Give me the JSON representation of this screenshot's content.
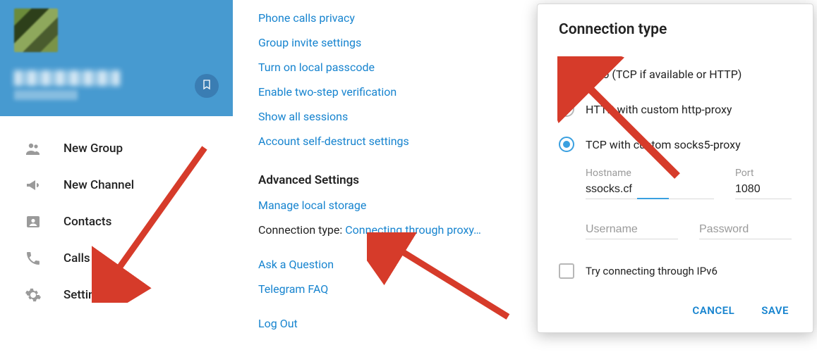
{
  "sidebar": {
    "items": [
      {
        "label": "New Group",
        "icon": "people"
      },
      {
        "label": "New Channel",
        "icon": "megaphone"
      },
      {
        "label": "Contacts",
        "icon": "person"
      },
      {
        "label": "Calls",
        "icon": "phone"
      },
      {
        "label": "Settings",
        "icon": "gear"
      }
    ]
  },
  "main": {
    "privacy_links": [
      "Phone calls privacy",
      "Group invite settings",
      "Turn on local passcode",
      "Enable two-step verification",
      "Show all sessions",
      "Account self-destruct settings"
    ],
    "advanced_heading": "Advanced Settings",
    "advanced_links": {
      "manage_storage": "Manage local storage",
      "conn_label": "Connection type:",
      "conn_value": "Connecting through proxy…",
      "ask": "Ask a Question",
      "faq": "Telegram FAQ",
      "logout": "Log Out"
    }
  },
  "dialog": {
    "title": "Connection type",
    "options": [
      {
        "label": "Auto (TCP if available or HTTP)",
        "checked": false
      },
      {
        "label": "HTTP with custom http-proxy",
        "checked": false
      },
      {
        "label": "TCP with custom socks5-proxy",
        "checked": true
      }
    ],
    "fields": {
      "hostname_label": "Hostname",
      "hostname_value": "ssocks.cf",
      "port_label": "Port",
      "port_value": "1080",
      "username_placeholder": "Username",
      "password_placeholder": "Password"
    },
    "ipv6_label": "Try connecting through IPv6",
    "cancel": "CANCEL",
    "save": "SAVE"
  }
}
